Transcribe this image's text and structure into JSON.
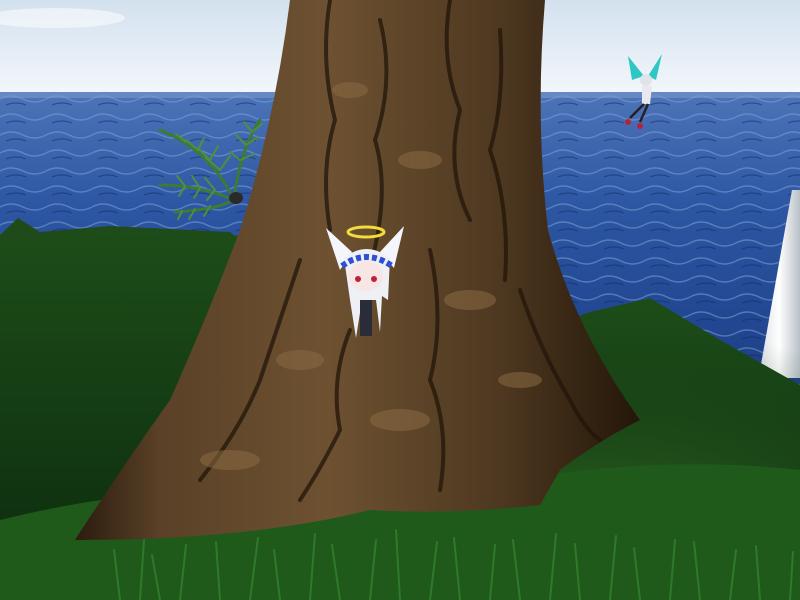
{
  "scene": {
    "world": "virtual-world-island",
    "palette": {
      "sky_top": "#dbe6f1",
      "sky_horizon": "#f2f6fa",
      "sea_deep": "#1c3e86",
      "sea_light": "#5b82c4",
      "grass_dark": "#0f3a12",
      "grass_light": "#2f6b23",
      "bark_dark": "#2b1d10",
      "bark_mid": "#5b4228",
      "bark_light": "#8a6a44",
      "fern": "#3e7a35",
      "halo": "#f3dc3a",
      "headband": "#2f4fd6",
      "wing_teal": "#2ec7c4"
    },
    "objects": [
      "sky",
      "ocean",
      "grass-hill",
      "tree-trunk",
      "fern-plant",
      "angel-avatar",
      "fairy-avatar",
      "white-pillar"
    ]
  }
}
